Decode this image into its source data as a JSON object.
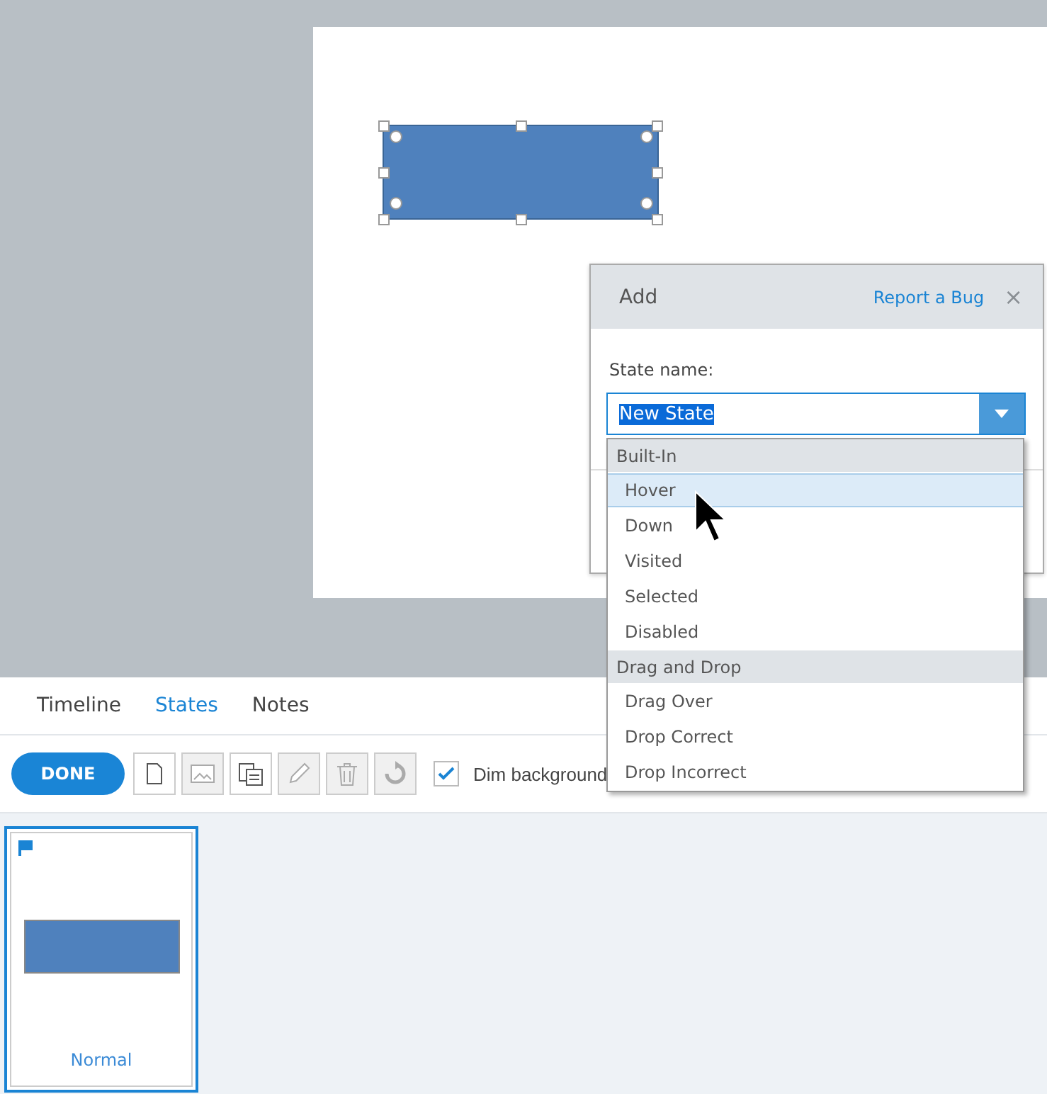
{
  "dialog": {
    "title": "Add",
    "link": "Report a Bug",
    "close": "×",
    "field_label": "State name:",
    "value": "New State",
    "groups": [
      {
        "title": "Built-In",
        "items": [
          {
            "label": "Hover",
            "selected": true
          },
          {
            "label": "Down",
            "selected": false
          },
          {
            "label": "Visited",
            "selected": false
          },
          {
            "label": "Selected",
            "selected": false
          },
          {
            "label": "Disabled",
            "selected": false
          }
        ]
      },
      {
        "title": "Drag and Drop",
        "items": [
          {
            "label": "Drag Over",
            "selected": false
          },
          {
            "label": "Drop Correct",
            "selected": false
          },
          {
            "label": "Drop Incorrect",
            "selected": false
          }
        ]
      }
    ]
  },
  "tabs": [
    {
      "label": "Timeline",
      "selected": false
    },
    {
      "label": "States",
      "selected": true
    },
    {
      "label": "Notes",
      "selected": false
    }
  ],
  "toolbar": {
    "done": "DONE",
    "tools": [
      {
        "kind": "new",
        "disabled": false
      },
      {
        "kind": "image",
        "disabled": true
      },
      {
        "kind": "duplicate",
        "disabled": false
      },
      {
        "kind": "edit",
        "disabled": true
      },
      {
        "kind": "delete",
        "disabled": true
      },
      {
        "kind": "reset",
        "disabled": true
      }
    ],
    "dim_checkbox": {
      "label": "Dim background",
      "checked": true
    }
  },
  "states": [
    {
      "label": "Normal",
      "selected": true
    }
  ]
}
